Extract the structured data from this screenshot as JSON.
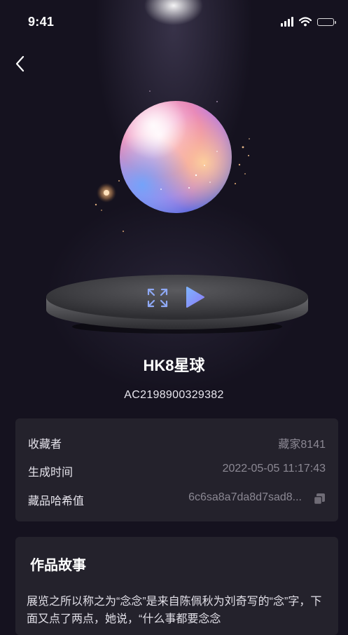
{
  "status_bar": {
    "time": "9:41"
  },
  "nav": {
    "back_icon": "chevron-left-icon"
  },
  "player": {
    "expand_icon": "expand-icon",
    "play_icon": "play-icon",
    "accent": "#8b7cf5"
  },
  "artwork": {
    "title": "HK8星球",
    "serial": "AC2198900329382"
  },
  "info": {
    "rows": [
      {
        "label": "收藏者",
        "value": "藏家8141"
      },
      {
        "label": "生成时间",
        "value": "2022-05-05 11:17:43"
      },
      {
        "label": "藏品哈希值",
        "value": "6c6sa8a7da8d7sad8..."
      }
    ],
    "copy_icon": "copy-icon"
  },
  "story": {
    "title": "作品故事",
    "text": "展览之所以称之为“念念”是来自陈佩秋为刘奇写的“念”字，下面又点了两点，她说，“什么事都要念念"
  }
}
